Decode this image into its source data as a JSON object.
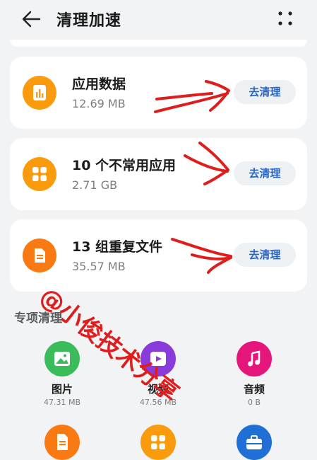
{
  "header": {
    "title": "清理加速",
    "back_icon": "arrow-left-icon",
    "more_icon": "more-dots-icon"
  },
  "cards": [
    {
      "title": "应用数据",
      "size": "12.69 MB",
      "button": "去清理",
      "icon": "bar-chart-icon"
    },
    {
      "title": "10 个不常用应用",
      "size": "2.71 GB",
      "button": "去清理",
      "icon": "apps-grid-icon"
    },
    {
      "title": "13 组重复文件",
      "size": "35.57 MB",
      "button": "去清理",
      "icon": "files-icon"
    }
  ],
  "special": {
    "title": "专项清理",
    "items": [
      {
        "label": "图片",
        "size": "47.31 MB",
        "icon": "image-icon",
        "color": "#3bbc5a"
      },
      {
        "label": "视频",
        "size": "47.56 MB",
        "icon": "video-icon",
        "color": "#8a3bdc"
      },
      {
        "label": "音频",
        "size": "0 B",
        "icon": "music-icon",
        "color": "#e5157b"
      },
      {
        "icon": "document-icon",
        "color": "#f97a12"
      },
      {
        "icon": "apps-icon",
        "color": "#f99b0c"
      },
      {
        "icon": "toolbox-icon",
        "color": "#1f6fd6"
      }
    ]
  },
  "watermark": "@小俊技术分享",
  "colors": {
    "accent": "#2665c5",
    "card_icon": "#f99b0c",
    "annotation": "#e01d1d",
    "background": "#f1f3f5"
  }
}
